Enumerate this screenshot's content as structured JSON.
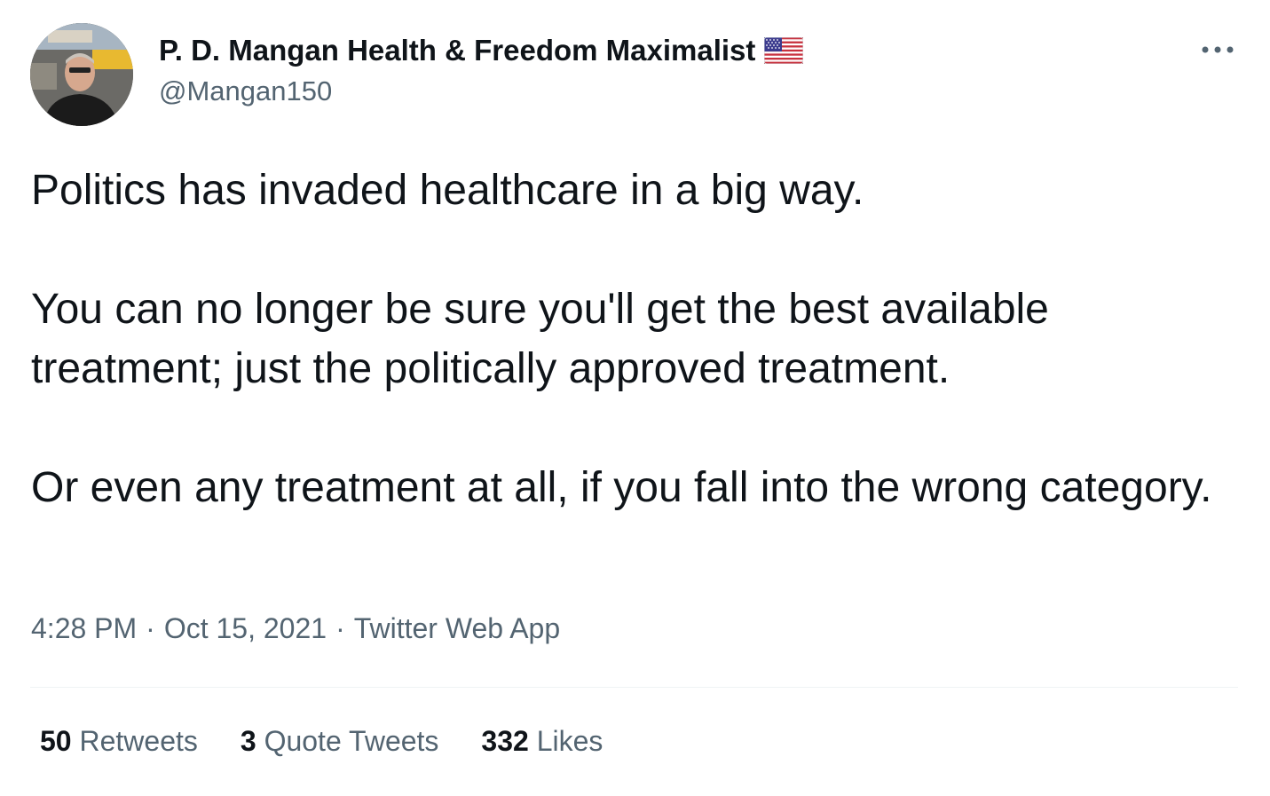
{
  "author": {
    "display_name": "P. D. Mangan Health & Freedom Maximalist",
    "handle": "@Mangan150",
    "flag_icon": "us-flag-icon",
    "avatar_icon": "profile-photo"
  },
  "menu": {
    "more_icon": "more-horizontal-icon"
  },
  "tweet": {
    "paragraphs": [
      "Politics has invaded healthcare in a big way.",
      "You can no longer be sure you'll get the best available treatment; just the politically approved treatment.",
      "Or even any treatment at all, if you fall into the wrong category."
    ],
    "time": "4:28 PM",
    "separator": "·",
    "date": "Oct 15, 2021",
    "source": "Twitter Web App"
  },
  "stats": {
    "retweets_count": "50",
    "retweets_label": "Retweets",
    "quotes_count": "3",
    "quotes_label": "Quote Tweets",
    "likes_count": "332",
    "likes_label": "Likes"
  },
  "colors": {
    "text_primary": "#0f1419",
    "text_secondary": "#536471",
    "divider": "#eff3f4"
  }
}
